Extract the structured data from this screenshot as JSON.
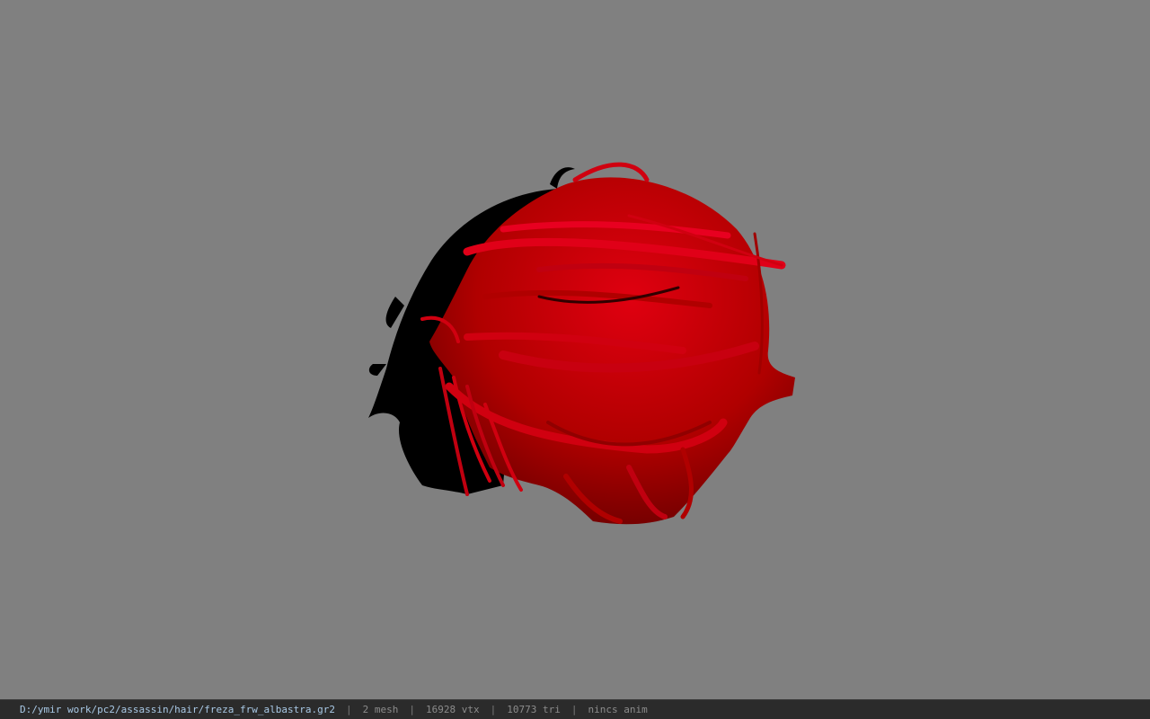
{
  "viewer": {
    "background_color": "#808080",
    "model_colors": {
      "mesh_primary": "#c00000",
      "mesh_secondary": "#000000"
    }
  },
  "status_bar": {
    "file_path": "D:/ymir work/pc2/assassin/hair/freza_frw_albastra.gr2",
    "separator": "|",
    "mesh_count": "2 mesh",
    "vertex_count": "16928 vtx",
    "triangle_count": "10773 tri",
    "anim_status": "nincs anim"
  }
}
